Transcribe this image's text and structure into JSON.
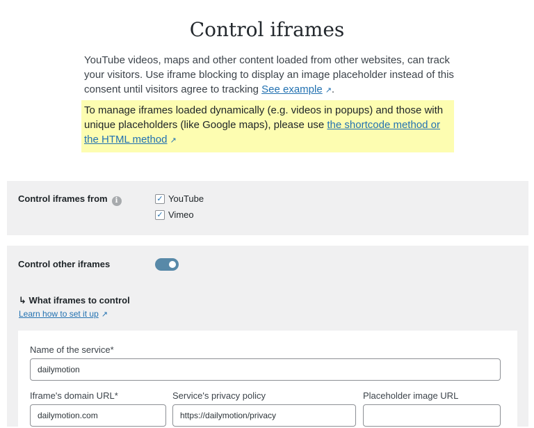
{
  "page": {
    "title": "Control iframes",
    "intro": "YouTube videos, maps and other content loaded from other websites, can track your visitors. Use iframe blocking to display an image placeholder instead of this consent until visitors agree to tracking",
    "see_example": "See example",
    "intro_end": ".",
    "note": "To manage iframes loaded dynamically (e.g. videos in popups) and those with unique placeholders (like Google maps), please use",
    "note_link": "the shortcode method or the HTML method"
  },
  "control_from": {
    "label": "Control iframes from",
    "options": [
      {
        "label": "YouTube",
        "checked": true
      },
      {
        "label": "Vimeo",
        "checked": true
      }
    ]
  },
  "control_other": {
    "label": "Control other iframes",
    "toggle_on": true,
    "what_label": "↳ What iframes to control",
    "learn_link": "Learn how to set it up"
  },
  "service_form": {
    "name_label": "Name of the service*",
    "name_value": "dailymotion",
    "domain_label": "Iframe's domain URL*",
    "domain_value": "dailymotion.com",
    "privacy_label": "Service's privacy policy",
    "privacy_value": "https://dailymotion/privacy",
    "placeholder_label": "Placeholder image URL",
    "placeholder_value": ""
  },
  "colors": {
    "accent": "#2271b1",
    "highlight": "#fdfdb1",
    "panel": "#f0f0f1",
    "toggle": "#5889a8"
  }
}
